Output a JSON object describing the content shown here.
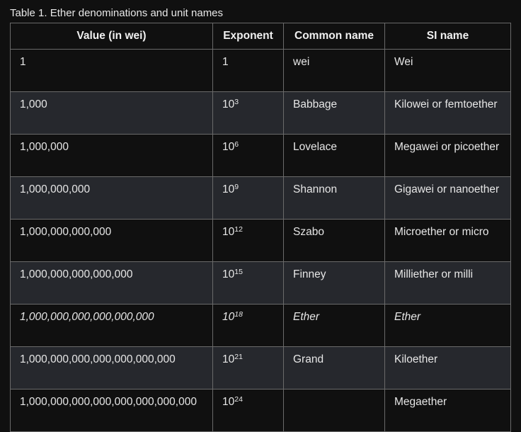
{
  "caption": "Table 1. Ether denominations and unit names",
  "headers": [
    "Value (in wei)",
    "Exponent",
    "Common name",
    "SI name"
  ],
  "rows": [
    {
      "value": "1",
      "exp_base": "1",
      "exp_pow": "",
      "common": "wei",
      "si": "Wei",
      "italic": false
    },
    {
      "value": "1,000",
      "exp_base": "10",
      "exp_pow": "3",
      "common": "Babbage",
      "si": "Kilowei or femtoether",
      "italic": false
    },
    {
      "value": "1,000,000",
      "exp_base": "10",
      "exp_pow": "6",
      "common": "Lovelace",
      "si": "Megawei or picoether",
      "italic": false
    },
    {
      "value": "1,000,000,000",
      "exp_base": "10",
      "exp_pow": "9",
      "common": "Shannon",
      "si": "Gigawei or nanoether",
      "italic": false
    },
    {
      "value": "1,000,000,000,000",
      "exp_base": "10",
      "exp_pow": "12",
      "common": "Szabo",
      "si": "Microether or micro",
      "italic": false
    },
    {
      "value": "1,000,000,000,000,000",
      "exp_base": "10",
      "exp_pow": "15",
      "common": "Finney",
      "si": "Milliether or milli",
      "italic": false
    },
    {
      "value": "1,000,000,000,000,000,000",
      "exp_base": "10",
      "exp_pow": "18",
      "common": "Ether",
      "si": "Ether",
      "italic": true
    },
    {
      "value": "1,000,000,000,000,000,000,000",
      "exp_base": "10",
      "exp_pow": "21",
      "common": "Grand",
      "si": "Kiloether",
      "italic": false
    },
    {
      "value": "1,000,000,000,000,000,000,000,000",
      "exp_base": "10",
      "exp_pow": "24",
      "common": "",
      "si": "Megaether",
      "italic": false
    }
  ]
}
